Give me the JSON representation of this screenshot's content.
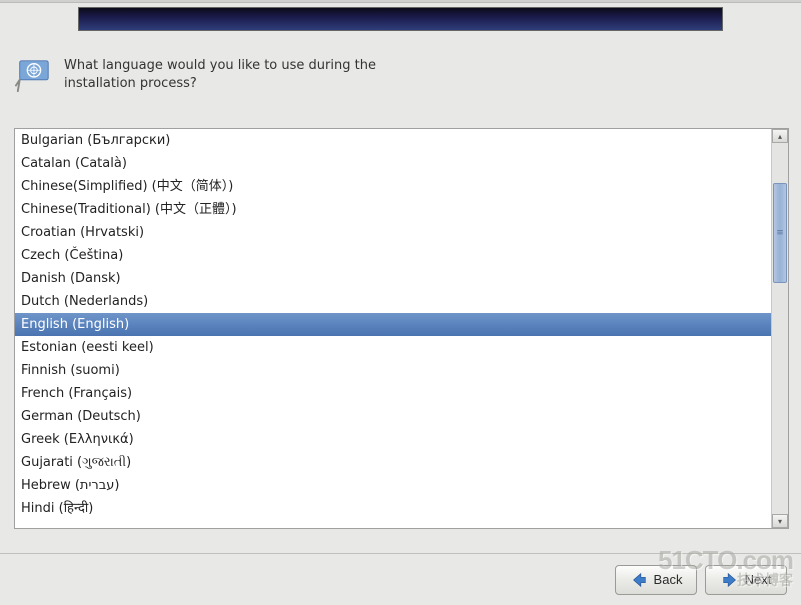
{
  "prompt": "What language would you like to use during the installation process?",
  "selected_index": 8,
  "languages": [
    "Bulgarian (Български)",
    "Catalan (Català)",
    "Chinese(Simplified) (中文（简体）)",
    "Chinese(Traditional) (中文（正體）)",
    "Croatian (Hrvatski)",
    "Czech (Čeština)",
    "Danish (Dansk)",
    "Dutch (Nederlands)",
    "English (English)",
    "Estonian (eesti keel)",
    "Finnish (suomi)",
    "French (Français)",
    "German (Deutsch)",
    "Greek (Ελληνικά)",
    "Gujarati (ગુજરાતી)",
    "Hebrew (עברית)",
    "Hindi (हिन्दी)"
  ],
  "buttons": {
    "back": "Back",
    "next": "Next"
  },
  "watermark": {
    "main": "51CTO.com",
    "sub": "技术博客"
  }
}
